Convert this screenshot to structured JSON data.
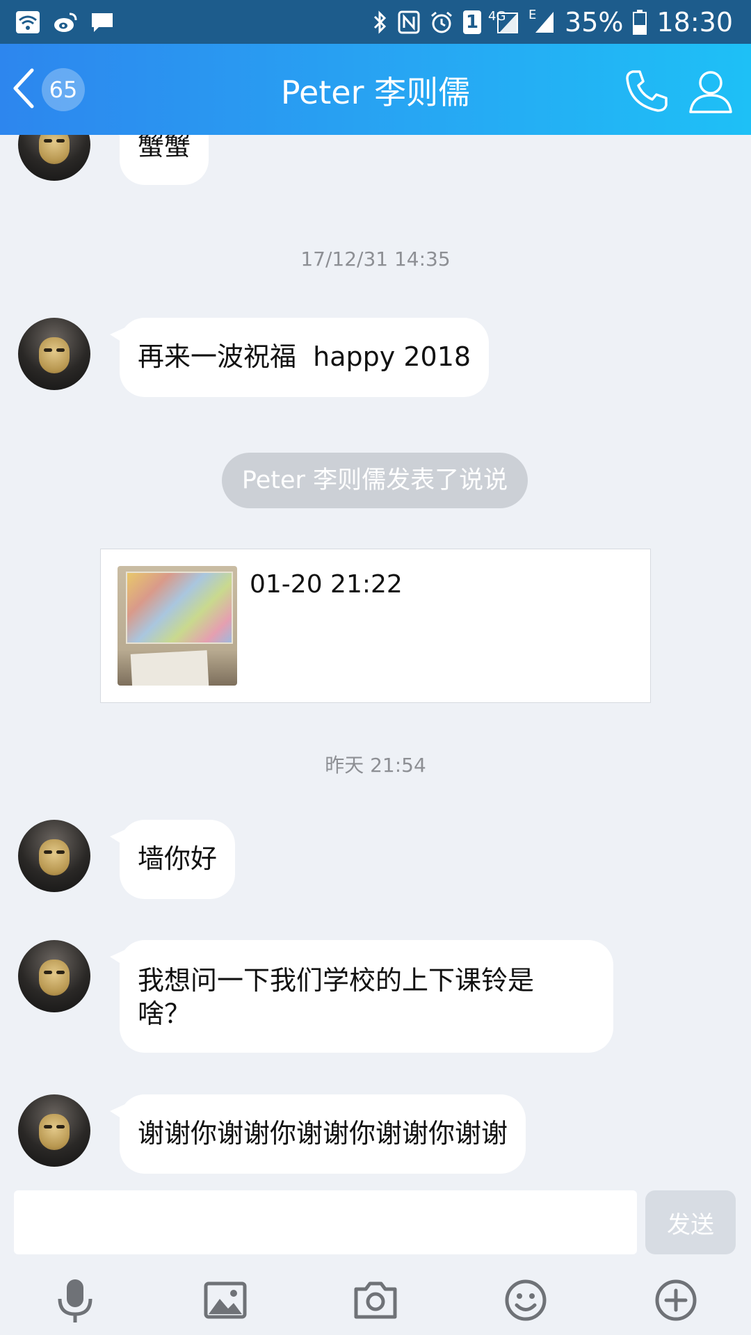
{
  "status_bar": {
    "icons_left": [
      "wifi-icon",
      "weibo-icon",
      "message-icon"
    ],
    "icons_right": [
      "bluetooth-icon",
      "nfc-icon",
      "alarm-icon",
      "sim-icon",
      "4g-signal-icon",
      "edge-signal-icon"
    ],
    "sim_label": "1",
    "network_4g": "4G",
    "network_e": "E",
    "battery": "35%",
    "time": "18:30"
  },
  "header": {
    "unread_count": "65",
    "title": "Peter 李则儒",
    "icons": [
      "back-icon",
      "phone-icon",
      "profile-icon"
    ]
  },
  "messages": [
    {
      "text": "蟹蟹"
    },
    {
      "text": "再来一波祝福  happy 2018"
    },
    {
      "text": "墙你好"
    },
    {
      "text": "我想问一下我们学校的上下课铃是\n啥？"
    },
    {
      "text": "谢谢你谢谢你谢谢你谢谢你谢谢"
    }
  ],
  "timestamps": [
    "17/12/31 14:35",
    "昨天 21:54"
  ],
  "system_notice": "Peter 李则儒发表了说说",
  "moment": {
    "time": "01-20 21:22"
  },
  "input": {
    "placeholder": "",
    "value": "",
    "send_label": "发送"
  },
  "toolbar_icons": [
    "microphone-icon",
    "image-icon",
    "camera-icon",
    "emoji-icon",
    "plus-icon"
  ]
}
